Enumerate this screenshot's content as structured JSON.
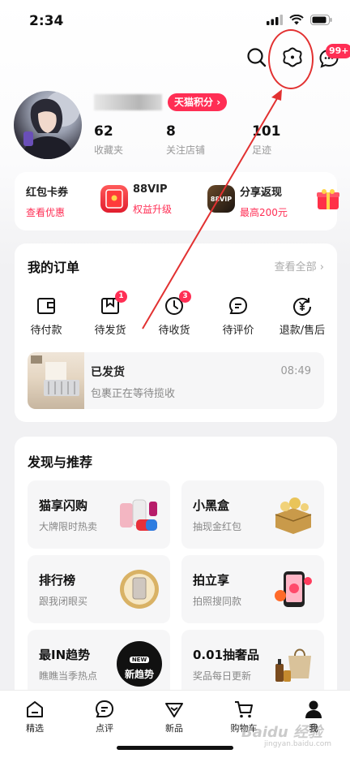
{
  "status_bar": {
    "time": "2:34"
  },
  "header": {
    "message_badge": "99+"
  },
  "profile": {
    "tmall_points_label": "天猫积分",
    "stats": [
      {
        "value": "62",
        "label": "收藏夹"
      },
      {
        "value": "8",
        "label": "关注店铺"
      },
      {
        "value": "101",
        "label": "足迹"
      }
    ]
  },
  "perks": [
    {
      "title": "红包卡券",
      "subtitle": "查看优惠"
    },
    {
      "title": "88VIP",
      "subtitle": "权益升级",
      "image_text": "88VIP"
    },
    {
      "title": "分享返现",
      "subtitle": "最高200元"
    }
  ],
  "orders": {
    "title": "我的订单",
    "see_all": "查看全部 ›",
    "items": [
      {
        "label": "待付款",
        "icon": "wallet-icon",
        "badge": ""
      },
      {
        "label": "待发货",
        "icon": "package-icon",
        "badge": "1"
      },
      {
        "label": "待收货",
        "icon": "clock-icon",
        "badge": "3"
      },
      {
        "label": "待评价",
        "icon": "comment-icon",
        "badge": ""
      },
      {
        "label": "退款/售后",
        "icon": "refund-icon",
        "badge": ""
      }
    ],
    "shipment": {
      "status": "已发货",
      "detail": "包裹正在等待揽收",
      "time": "08:49"
    }
  },
  "discover": {
    "title": "发现与推荐",
    "items": [
      {
        "title": "猫享闪购",
        "subtitle": "大牌限时热卖",
        "icon": "gadgets-icon"
      },
      {
        "title": "小黑盒",
        "subtitle": "抽现金红包",
        "icon": "treasure-box-icon"
      },
      {
        "title": "排行榜",
        "subtitle": "跟我闭眼买",
        "icon": "ranking-medal-icon"
      },
      {
        "title": "拍立享",
        "subtitle": "拍照搜同款",
        "icon": "camera-phone-icon"
      },
      {
        "title": "最IN趋势",
        "subtitle": "瞧瞧当季热点",
        "icon": "new-trend-icon",
        "image_text": "新趋势",
        "image_tag": "NEW"
      },
      {
        "title": "0.01抽奢品",
        "subtitle": "奖品每日更新",
        "icon": "luxury-goods-icon"
      }
    ]
  },
  "bottom_nav": [
    {
      "label": "精选",
      "icon": "home-icon"
    },
    {
      "label": "点评",
      "icon": "review-icon"
    },
    {
      "label": "新品",
      "icon": "new-arrivals-icon"
    },
    {
      "label": "购物车",
      "icon": "cart-icon"
    },
    {
      "label": "我",
      "icon": "profile-icon"
    }
  ],
  "watermark": {
    "main": "Baidu 经验",
    "sub": "jingyan.baidu.com"
  },
  "colors": {
    "accent": "#ff2e54",
    "annotation": "#e23131"
  }
}
